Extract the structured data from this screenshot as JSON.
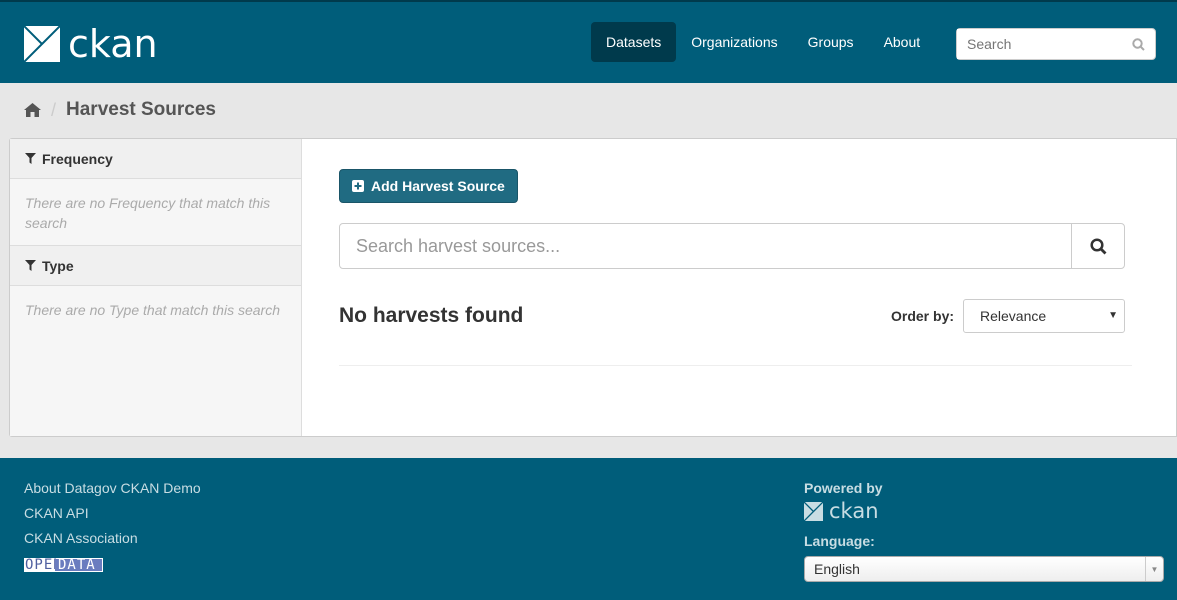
{
  "header": {
    "brand": "ckan",
    "nav": [
      {
        "label": "Datasets",
        "active": true
      },
      {
        "label": "Organizations"
      },
      {
        "label": "Groups"
      },
      {
        "label": "About"
      }
    ],
    "search_placeholder": "Search"
  },
  "breadcrumb": {
    "home_icon": "home-icon",
    "current": "Harvest Sources"
  },
  "facets": [
    {
      "title": "Frequency",
      "empty": "There are no Frequency that match this search"
    },
    {
      "title": "Type",
      "empty": "There are no Type that match this search"
    }
  ],
  "main": {
    "add_label": "Add Harvest Source",
    "search_placeholder": "Search harvest sources...",
    "result": "No harvests found",
    "order_label": "Order by:",
    "order_value": "Relevance"
  },
  "footer": {
    "links": [
      "About Datagov CKAN Demo",
      "CKAN API",
      "CKAN Association"
    ],
    "open_data": [
      "OPEN",
      "DATA"
    ],
    "powered": "Powered by",
    "powered_brand": "ckan",
    "language_label": "Language:",
    "language_value": "English"
  },
  "colors": {
    "header": "#005d7a",
    "active_nav": "#003a4c",
    "button": "#206b82"
  }
}
